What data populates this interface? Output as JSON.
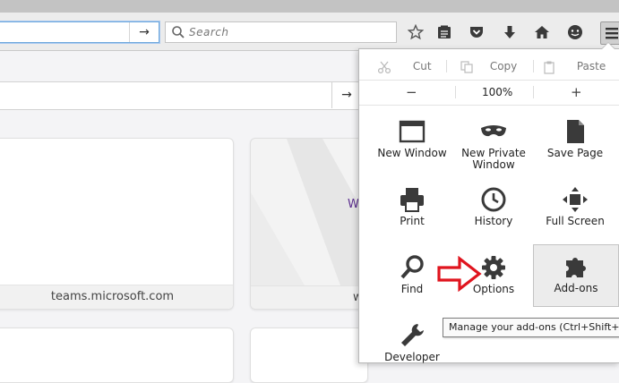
{
  "toolbar": {
    "search_placeholder": "Search",
    "url_go": "→",
    "icons": [
      "star-icon",
      "reading-list-icon",
      "pocket-icon",
      "downloads-icon",
      "home-icon",
      "chat-icon",
      "hamburger-menu-icon"
    ]
  },
  "page": {
    "search_go": "→",
    "tiles": [
      {
        "label": "teams.microsoft.com"
      },
      {
        "label": "w",
        "preview_text": "W"
      }
    ]
  },
  "menu": {
    "edit": {
      "cut": "Cut",
      "copy": "Copy",
      "paste": "Paste"
    },
    "zoom": {
      "minus": "−",
      "level": "100%",
      "plus": "+"
    },
    "items": [
      {
        "label": "New Window",
        "icon": "window-icon"
      },
      {
        "label": "New Private Window",
        "icon": "mask-icon"
      },
      {
        "label": "Save Page",
        "icon": "page-icon"
      },
      {
        "label": "Print",
        "icon": "printer-icon"
      },
      {
        "label": "History",
        "icon": "clock-icon"
      },
      {
        "label": "Full Screen",
        "icon": "fullscreen-icon"
      },
      {
        "label": "Find",
        "icon": "magnifier-icon"
      },
      {
        "label": "Options",
        "icon": "gear-icon"
      },
      {
        "label": "Add-ons",
        "icon": "puzzle-icon"
      },
      {
        "label": "Developer",
        "icon": "wrench-icon"
      }
    ],
    "tooltip": "Manage your add-ons (Ctrl+Shift+A)"
  },
  "colors": {
    "accent_red": "#e0141e",
    "url_focus": "#6fa8dc"
  }
}
